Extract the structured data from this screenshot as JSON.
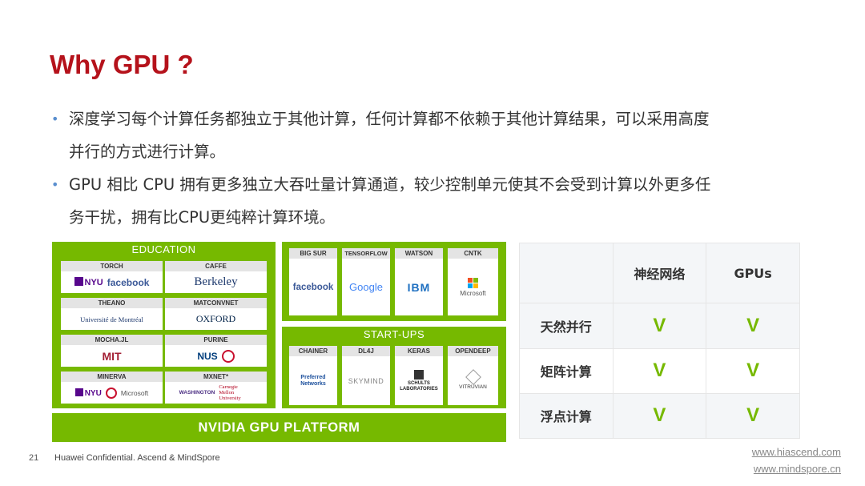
{
  "slide": {
    "title": "Why GPU ?",
    "bullets": [
      "深度学习每个计算任务都独立于其他计算，任何计算都不依赖于其他计算结果，可以采用高度",
      "并行的方式进行计算。",
      "GPU 相比 CPU 拥有更多独立大吞吐量计算通道，较少控制单元使其不会受到计算以外更多任",
      "务干扰，拥有比CPU更纯粹计算环境。"
    ]
  },
  "platform": {
    "education_header": "EDUCATION",
    "startups_header": "START-UPS",
    "nvidia_bar": "NVIDIA GPU PLATFORM",
    "education": [
      {
        "label": "TORCH",
        "logos": [
          "NYU",
          "facebook"
        ]
      },
      {
        "label": "CAFFE",
        "logos": [
          "Berkeley"
        ]
      },
      {
        "label": "THEANO",
        "logos": [
          "Université de Montréal"
        ]
      },
      {
        "label": "MATCONVNET",
        "logos": [
          "OXFORD"
        ]
      },
      {
        "label": "MOCHA.JL",
        "logos": [
          "MIT"
        ]
      },
      {
        "label": "PURINE",
        "logos": [
          "NUS"
        ]
      },
      {
        "label": "MINERVA",
        "logos": [
          "NYU",
          "Microsoft"
        ]
      },
      {
        "label": "MXNET*",
        "logos": [
          "WASHINGTON",
          "Carnegie Mellon University"
        ]
      }
    ],
    "industry": [
      {
        "label": "BIG SUR",
        "logos": [
          "facebook"
        ]
      },
      {
        "label": "TENSORFLOW",
        "logos": [
          "Google"
        ]
      },
      {
        "label": "WATSON",
        "logos": [
          "IBM"
        ]
      },
      {
        "label": "CNTK",
        "logos": [
          "Microsoft"
        ]
      }
    ],
    "startups": [
      {
        "label": "CHAINER",
        "logos": [
          "Preferred Networks"
        ]
      },
      {
        "label": "DL4J",
        "logos": [
          "SKYMIND"
        ]
      },
      {
        "label": "KERAS",
        "logos": [
          "SCHULTS LABORATORIES"
        ]
      },
      {
        "label": "OPENDEEP",
        "logos": [
          "VITRUVIAN"
        ]
      }
    ]
  },
  "comparison": {
    "headers": [
      "",
      "神经网络",
      "GPUs"
    ],
    "rows": [
      {
        "label": "天然并行",
        "c1": "V",
        "c2": "V"
      },
      {
        "label": "矩阵计算",
        "c1": "V",
        "c2": "V"
      },
      {
        "label": "浮点计算",
        "c1": "V",
        "c2": "V"
      }
    ]
  },
  "footer": {
    "page_number": "21",
    "text": "Huawei Confidential. Ascend & MindSpore",
    "link1": "www.hiascend.com",
    "link2": "www.mindspore.cn"
  },
  "colors": {
    "title_red": "#b5121b",
    "nvidia_green": "#76b900",
    "bullet_blue": "#5a8fcf"
  }
}
